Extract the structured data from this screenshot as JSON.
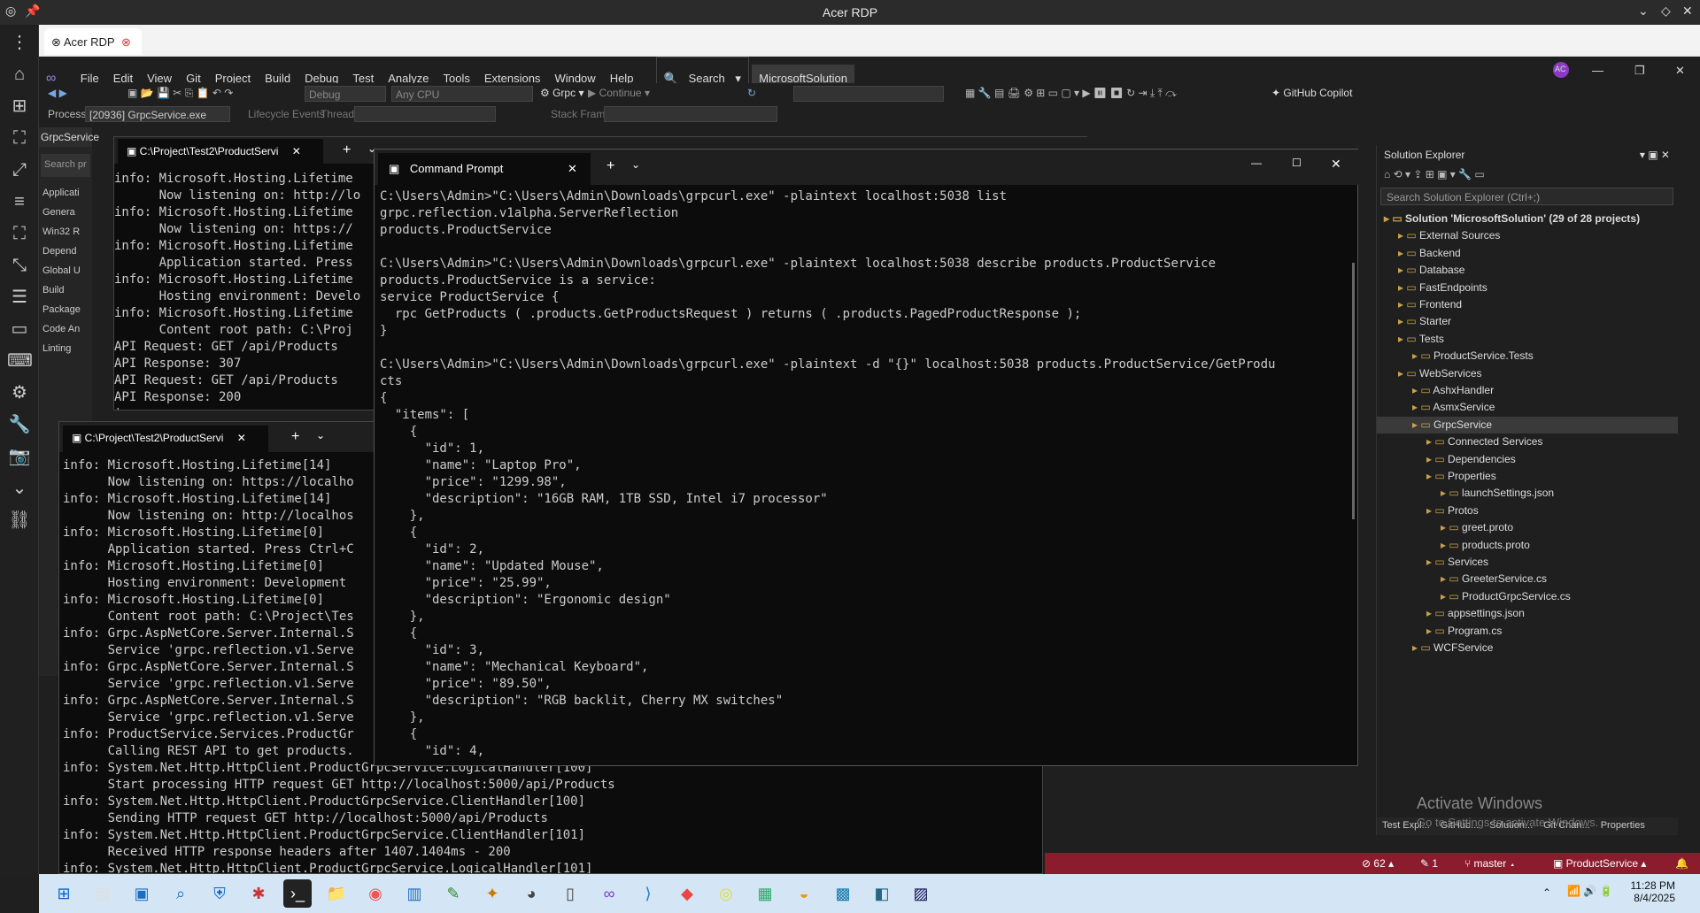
{
  "rdp": {
    "title": "Acer RDP",
    "tab_label": "Acer RDP"
  },
  "vs": {
    "menu": [
      "File",
      "Edit",
      "View",
      "Git",
      "Project",
      "Build",
      "Debug",
      "Test",
      "Analyze",
      "Tools",
      "Extensions",
      "Window",
      "Help"
    ],
    "search_label": "Search",
    "solution_name": "MicrosoftSolution",
    "user_badge": "AC",
    "config": "Debug",
    "platform": "Any CPU",
    "startup": "Grpc",
    "continue_label": "Continue",
    "copilot": "GitHub Copilot",
    "process_label": "Process:",
    "process_value": "[20936] GrpcService.exe",
    "lifecycle_label": "Lifecycle Events",
    "thread_label": "Thread:",
    "stackframe_label": "Stack Frame:"
  },
  "left_panel": {
    "tab": "GrpcService",
    "search_placeholder": "Search pr",
    "items": [
      "Applicati",
      "Genera",
      "Win32 R",
      "Depend",
      "Global U",
      "Build",
      "Package",
      "Code An",
      "Linting"
    ]
  },
  "term1": {
    "tab": "C:\\Project\\Test2\\ProductServi",
    "lines": [
      "info: Microsoft.Hosting.Lifetime",
      "      Now listening on: http://lo",
      "info: Microsoft.Hosting.Lifetime",
      "      Now listening on: https://",
      "info: Microsoft.Hosting.Lifetime",
      "      Application started. Press",
      "info: Microsoft.Hosting.Lifetime",
      "      Hosting environment: Develo",
      "info: Microsoft.Hosting.Lifetime",
      "      Content root path: C:\\Proj",
      "API Request: GET /api/Products",
      "API Response: 307",
      "API Request: GET /api/Products",
      "API Response: 200",
      "|"
    ]
  },
  "term2": {
    "tab": "C:\\Project\\Test2\\ProductServi",
    "lines": [
      "info: Microsoft.Hosting.Lifetime[14]",
      "      Now listening on: https://localho",
      "info: Microsoft.Hosting.Lifetime[14]",
      "      Now listening on: http://localhos",
      "info: Microsoft.Hosting.Lifetime[0]",
      "      Application started. Press Ctrl+C",
      "info: Microsoft.Hosting.Lifetime[0]",
      "      Hosting environment: Development",
      "info: Microsoft.Hosting.Lifetime[0]",
      "      Content root path: C:\\Project\\Tes",
      "info: Grpc.AspNetCore.Server.Internal.S",
      "      Service 'grpc.reflection.v1.Serve",
      "info: Grpc.AspNetCore.Server.Internal.S",
      "      Service 'grpc.reflection.v1.Serve",
      "info: Grpc.AspNetCore.Server.Internal.S",
      "      Service 'grpc.reflection.v1.Serve",
      "info: ProductService.Services.ProductGr",
      "      Calling REST API to get products.",
      "info: System.Net.Http.HttpClient.ProductGrpcService.LogicalHandler[100]",
      "      Start processing HTTP request GET http://localhost:5000/api/Products",
      "info: System.Net.Http.HttpClient.ProductGrpcService.ClientHandler[100]",
      "      Sending HTTP request GET http://localhost:5000/api/Products",
      "info: System.Net.Http.HttpClient.ProductGrpcService.ClientHandler[101]",
      "      Received HTTP response headers after 1407.1404ms - 200",
      "info: System.Net.Http.HttpClient.ProductGrpcService.LogicalHandler[101]"
    ]
  },
  "cmd": {
    "tab": "Command Prompt",
    "lines": [
      "C:\\Users\\Admin>\"C:\\Users\\Admin\\Downloads\\grpcurl.exe\" -plaintext localhost:5038 list",
      "grpc.reflection.v1alpha.ServerReflection",
      "products.ProductService",
      "",
      "C:\\Users\\Admin>\"C:\\Users\\Admin\\Downloads\\grpcurl.exe\" -plaintext localhost:5038 describe products.ProductService",
      "products.ProductService is a service:",
      "service ProductService {",
      "  rpc GetProducts ( .products.GetProductsRequest ) returns ( .products.PagedProductResponse );",
      "}",
      "",
      "C:\\Users\\Admin>\"C:\\Users\\Admin\\Downloads\\grpcurl.exe\" -plaintext -d \"{}\" localhost:5038 products.ProductService/GetProdu",
      "cts",
      "{",
      "  \"items\": [",
      "    {",
      "      \"id\": 1,",
      "      \"name\": \"Laptop Pro\",",
      "      \"price\": \"1299.98\",",
      "      \"description\": \"16GB RAM, 1TB SSD, Intel i7 processor\"",
      "    },",
      "    {",
      "      \"id\": 2,",
      "      \"name\": \"Updated Mouse\",",
      "      \"price\": \"25.99\",",
      "      \"description\": \"Ergonomic design\"",
      "    },",
      "    {",
      "      \"id\": 3,",
      "      \"name\": \"Mechanical Keyboard\",",
      "      \"price\": \"89.50\",",
      "      \"description\": \"RGB backlit, Cherry MX switches\"",
      "    },",
      "    {",
      "      \"id\": 4,"
    ]
  },
  "solution_explorer": {
    "title": "Solution Explorer",
    "search_placeholder": "Search Solution Explorer (Ctrl+;)",
    "items": [
      {
        "label": "Solution 'MicrosoftSolution' (29 of 28 projects)",
        "bold": true
      },
      {
        "label": "External Sources"
      },
      {
        "label": "Backend"
      },
      {
        "label": "Database"
      },
      {
        "label": "FastEndpoints"
      },
      {
        "label": "Frontend"
      },
      {
        "label": "Starter"
      },
      {
        "label": "Tests"
      },
      {
        "label": "ProductService.Tests"
      },
      {
        "label": "WebServices"
      },
      {
        "label": "AshxHandler"
      },
      {
        "label": "AsmxService"
      },
      {
        "label": "GrpcService",
        "selected": true
      },
      {
        "label": "Connected Services"
      },
      {
        "label": "Dependencies"
      },
      {
        "label": "Properties"
      },
      {
        "label": "launchSettings.json"
      },
      {
        "label": "Protos"
      },
      {
        "label": "greet.proto"
      },
      {
        "label": "products.proto"
      },
      {
        "label": "Services"
      },
      {
        "label": "GreeterService.cs"
      },
      {
        "label": "ProductGrpcService.cs"
      },
      {
        "label": "appsettings.json"
      },
      {
        "label": "Program.cs"
      },
      {
        "label": "WCFService"
      }
    ],
    "bottom_tabs": [
      "Test Expl...",
      "GitHub...",
      "Solution...",
      "Git Chan...",
      "Properties"
    ]
  },
  "watermark": {
    "title": "Activate Windows",
    "subtitle": "Go to Settings to activate Windows."
  },
  "status": {
    "errors": "62",
    "changes": "1",
    "branch": "master",
    "project": "ProductService"
  },
  "tray": {
    "time": "11:28 PM",
    "date": "8/4/2025"
  }
}
